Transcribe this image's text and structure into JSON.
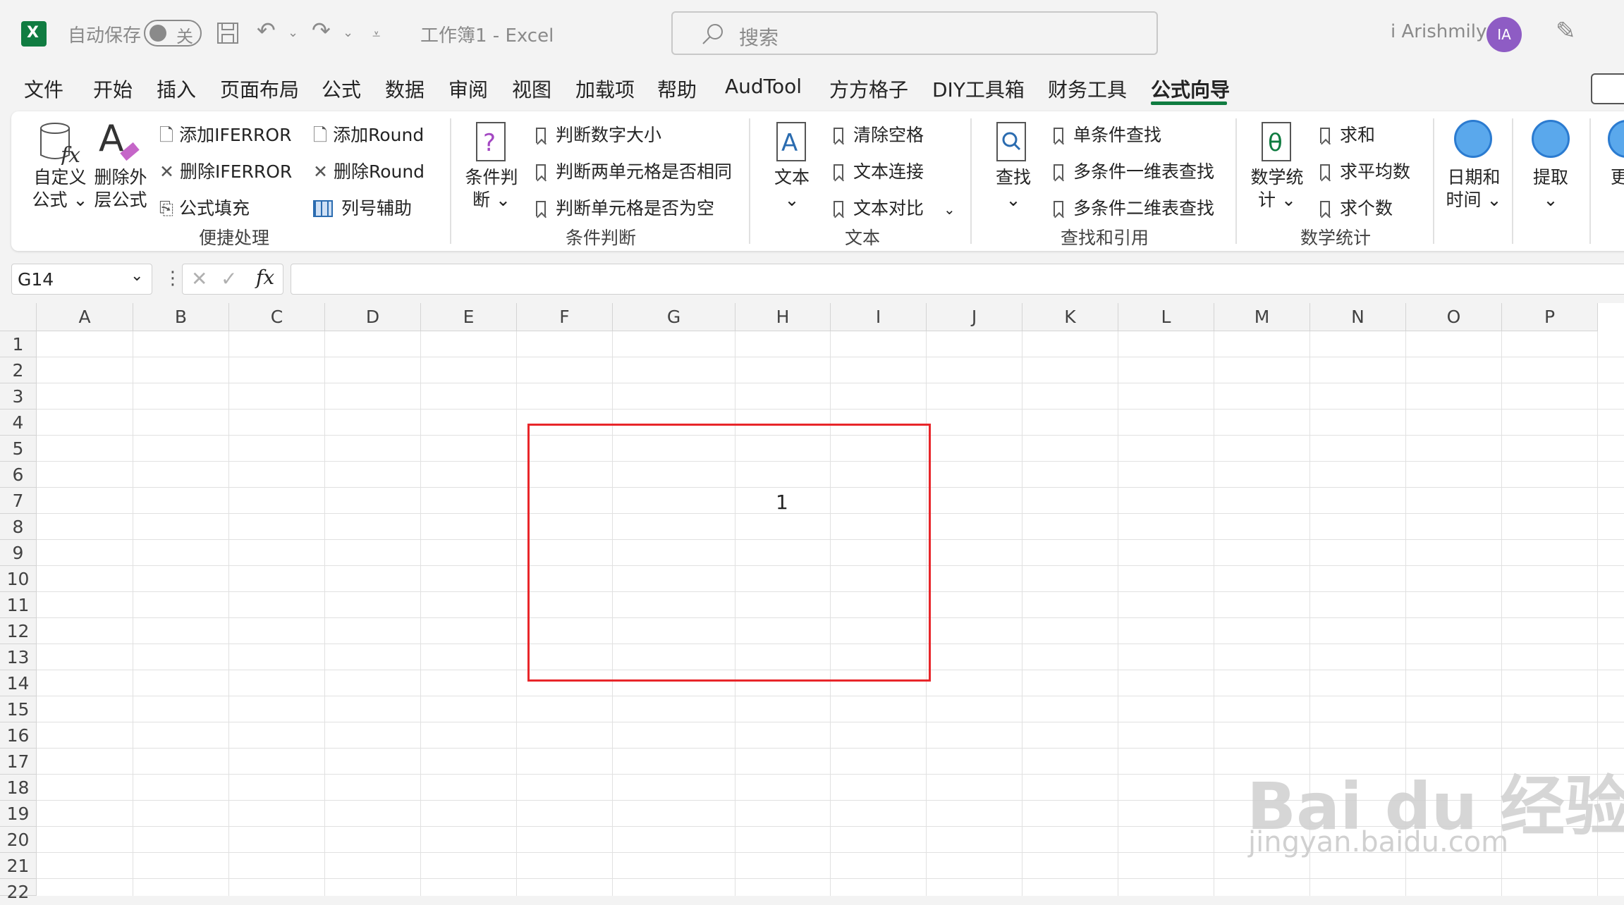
{
  "titlebar": {
    "autosave_label": "自动保存",
    "autosave_state": "关",
    "doc_title": "工作簿1  -  Excel",
    "search_placeholder": "搜索",
    "user_name": "i Arishmily",
    "user_initials": "IA"
  },
  "tabs": [
    "文件",
    "开始",
    "插入",
    "页面布局",
    "公式",
    "数据",
    "审阅",
    "视图",
    "加载项",
    "帮助",
    "AudTool",
    "方方格子",
    "DIY工具箱",
    "财务工具",
    "公式向导"
  ],
  "active_tab": "公式向导",
  "ribbon": {
    "quick": {
      "custom_formula": "自定义\n公式 ⌄",
      "remove_outer": "删除外\n层公式",
      "add_iferror": "添加IFERROR",
      "del_iferror": "删除IFERROR",
      "formula_fill": "公式填充",
      "add_round": "添加Round",
      "del_round": "删除Round",
      "col_helper": "列号辅助",
      "group": "便捷处理"
    },
    "cond": {
      "big": "条件判\n断 ⌄",
      "i1": "判断数字大小",
      "i2": "判断两单元格是否相同",
      "i3": "判断单元格是否为空",
      "group": "条件判断"
    },
    "text": {
      "big": "文本\n⌄",
      "i1": "清除空格",
      "i2": "文本连接",
      "i3": "文本对比",
      "group": "文本"
    },
    "lookup": {
      "big": "查找\n⌄",
      "i1": "单条件查找",
      "i2": "多条件一维表查找",
      "i3": "多条件二维表查找",
      "group": "查找和引用"
    },
    "math": {
      "big": "数学统\n计 ⌄",
      "i1": "求和",
      "i2": "求平均数",
      "i3": "求个数",
      "group": "数学统计"
    },
    "datetime": "日期和\n时间 ⌄",
    "extract": "提取\n⌄",
    "more": "更"
  },
  "formula_bar": {
    "name_box": "G14",
    "fx": "fx",
    "formula": ""
  },
  "columns": [
    "A",
    "B",
    "C",
    "D",
    "E",
    "F",
    "G",
    "H",
    "I",
    "J",
    "K",
    "L",
    "M",
    "N",
    "O",
    "P"
  ],
  "rows": [
    "1",
    "2",
    "3",
    "4",
    "5",
    "6",
    "7",
    "8",
    "9",
    "10",
    "11",
    "12",
    "13",
    "14",
    "15",
    "16",
    "17",
    "18",
    "19",
    "20",
    "21",
    "22"
  ],
  "cell_value": "1",
  "watermark": {
    "main": "Bai du 经验",
    "sub": "jingyan.baidu.com"
  },
  "colors": {
    "accent": "#107c41",
    "highlight": "#e8262a",
    "avatar": "#8e5cc4"
  }
}
